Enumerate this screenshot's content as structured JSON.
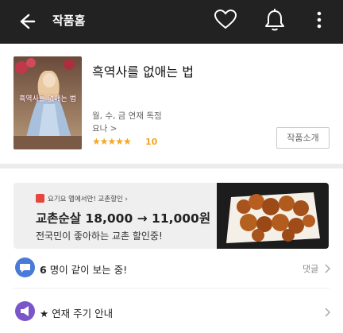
{
  "topbar": {
    "title": "작품홈",
    "icons": [
      "back-arrow-icon",
      "heart-icon",
      "bell-icon",
      "more-vertical-icon"
    ]
  },
  "work": {
    "title": "흑역사를 없애는 법",
    "cover_text": "흑역사를 없애는 법",
    "schedule": "월, 수, 금 연재 독점",
    "author": "요나 >",
    "stars": "★★★★★",
    "rating": "10",
    "intro_button": "작품소개"
  },
  "ad": {
    "small_text": "요기요 앱에서만! 교촌할인 ›",
    "price_text": "교촌순살 18,000 → 11,000원",
    "sub_text": "전국민이 좋아하는 교촌 할인중!"
  },
  "rows": {
    "watching_count": "6",
    "watching_text": "명이 같이 보는 중!",
    "comments_label": "댓글",
    "schedule_notice": "★ 연재 주기 안내"
  },
  "colors": {
    "topbar": "#222222",
    "star": "#f5a623",
    "watch_icon": "#4a7ad8",
    "notice_icon": "#7a56c9",
    "ad_badge": "#e8453c"
  }
}
